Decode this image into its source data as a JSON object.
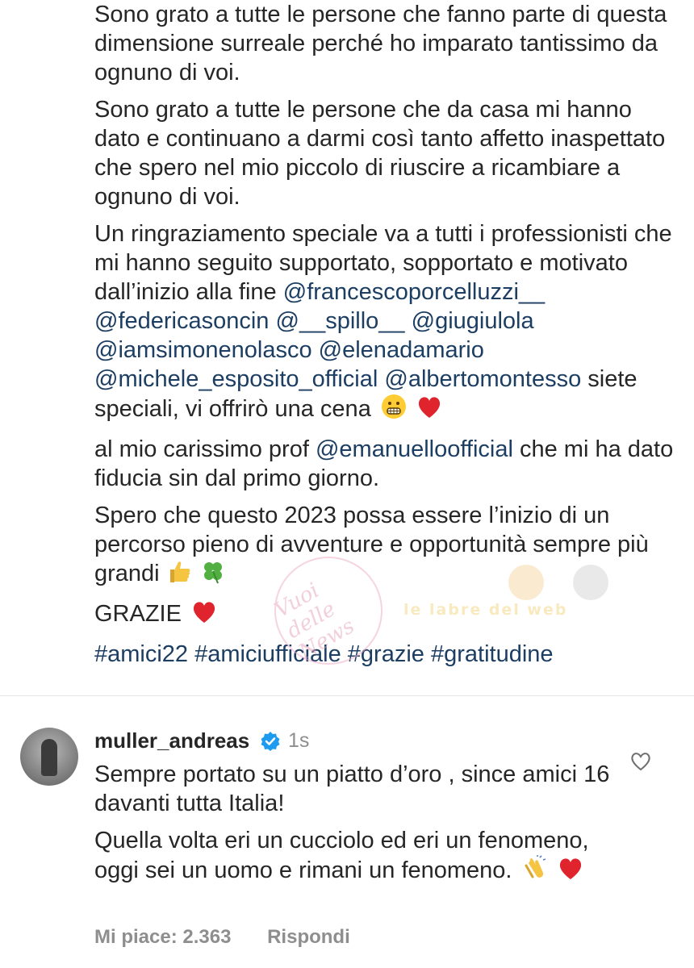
{
  "caption": {
    "p1": "Sono grato a tutte le persone che fanno parte di questa dimensione surreale perché ho imparato tantissimo da ognuno di voi.",
    "p2": "Sono grato a tutte le persone che da casa mi hanno dato e continuano a darmi così tanto affetto inaspettato che spero nel mio piccolo di riuscire a ricambiare a ognuno di voi.",
    "p3_text": "Un ringraziamento speciale va a tutti i professionisti che mi hanno seguito supportato, sopportato e motivato dall’inizio alla fine",
    "mentions": [
      "@francescoporcelluzzi__",
      "@federicasoncin",
      "@__spillo__",
      "@giugiulola",
      "@iamsimonenolasco",
      "@elenadamario",
      "@michele_esposito_official",
      "@albertomontesso"
    ],
    "p3_tail": "siete speciali, vi offrirò una cena",
    "p4_a": "al mio carissimo prof",
    "p4_mention": "@emanuelloofficial",
    "p4_b": "che mi ha dato fiducia sin dal primo giorno.",
    "p5": "Spero che questo 2023 possa essere l’inizio di un percorso pieno di avventure e opportunità sempre più grandi",
    "p6": "GRAZIE",
    "hashtags": [
      "#amici22",
      "#amiciufficiale",
      "#grazie",
      "#gratitudine"
    ]
  },
  "watermark": {
    "brand": "Vuoi delle News",
    "text": "le labre del web"
  },
  "comment": {
    "username": "muller_andreas",
    "time": "1s",
    "text_1": "Sempre portato su un piatto d’oro , since amici 16 davanti tutta Italia!",
    "text_2": "Quella volta eri un cucciolo ed eri un fenomeno, oggi sei un uomo e rimani un fenomeno.",
    "likes": "Mi piace: 2.363",
    "reply": "Rispondi"
  },
  "icons": {
    "heart": "red-heart-icon",
    "grimace": "grimacing-face-icon",
    "clap": "clapping-hands-icon",
    "verified": "verified-badge-icon",
    "like": "heart-outline-icon"
  },
  "colors": {
    "link": "#1c3e63",
    "text": "#262626",
    "muted": "#8e8e8e",
    "verified": "#1d9bf0",
    "heart": "#e0242e"
  }
}
